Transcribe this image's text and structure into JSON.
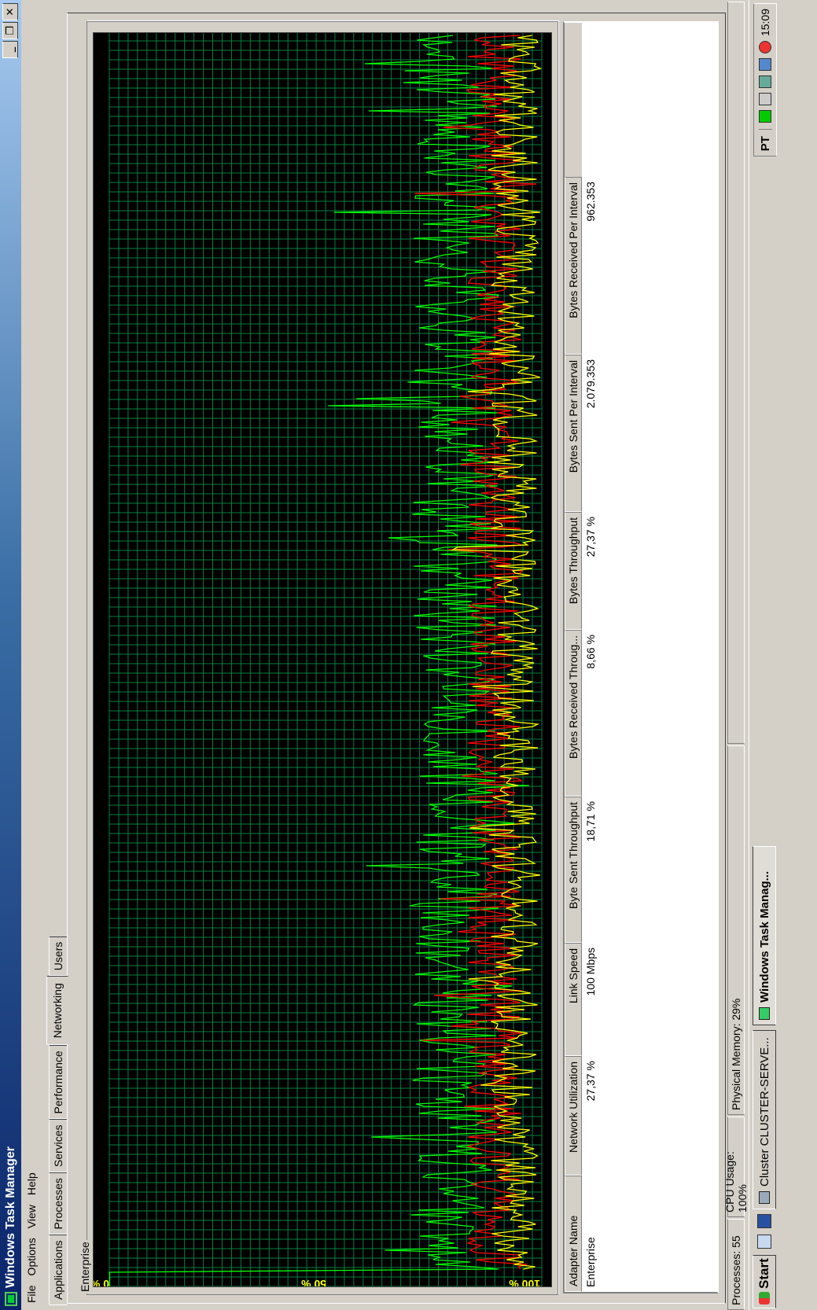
{
  "window": {
    "title": "Windows Task Manager",
    "buttons": {
      "minimize": "_",
      "restore": "❐",
      "close": "✕"
    }
  },
  "menu": [
    "File",
    "Options",
    "View",
    "Help"
  ],
  "tabs": {
    "items": [
      "Applications",
      "Processes",
      "Services",
      "Performance",
      "Networking",
      "Users"
    ],
    "active": "Networking"
  },
  "networking": {
    "adapter_label": "Enterprise",
    "graph": {
      "y_labels": [
        "100 %",
        "50 %",
        "0 %"
      ],
      "grid_color": "#008040",
      "series_colors": {
        "total": "#00ff00",
        "sent": "#ff0000",
        "received": "#ffff00"
      }
    },
    "table": {
      "columns": [
        "Adapter Name",
        "Network Utilization",
        "Link Speed",
        "Byte Sent Throughput",
        "Bytes Received Throug...",
        "Bytes Throughput",
        "Bytes Sent Per Interval",
        "Bytes Received Per Interval"
      ],
      "rows": [
        [
          "Enterprise",
          "27,37 %",
          "100 Mbps",
          "18,71 %",
          "8,66 %",
          "27,37 %",
          "2.079.353",
          "962.353"
        ]
      ]
    }
  },
  "statusbar": {
    "processes": "Processes: 55",
    "cpu": "CPU Usage: 100%",
    "memory": "Physical Memory: 29%"
  },
  "taskbar": {
    "start": "Start",
    "tasks": [
      "Cluster CLUSTER-SERVE...",
      "Windows Task Manag..."
    ],
    "language": "PT",
    "clock": "15:09"
  }
}
